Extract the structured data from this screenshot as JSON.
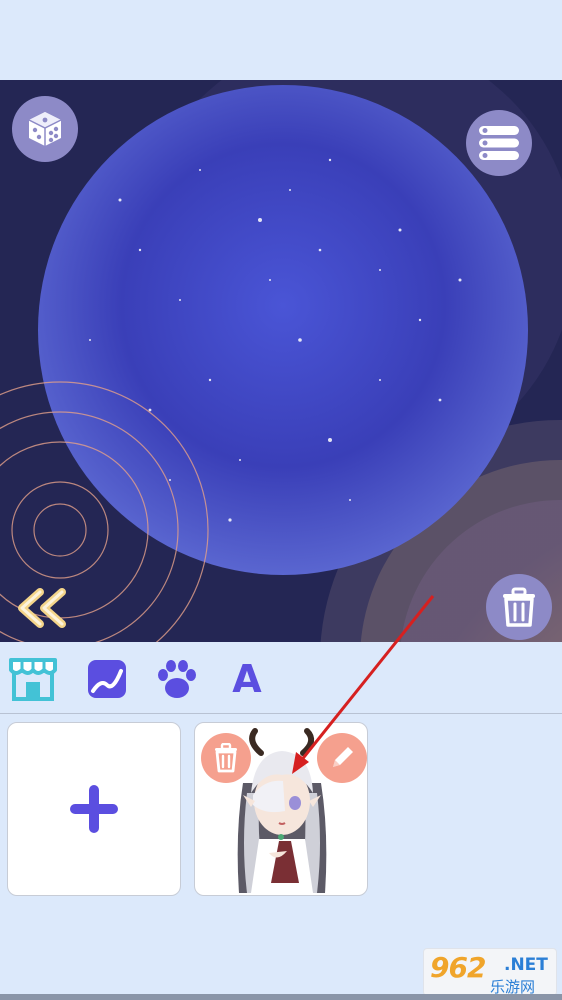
{
  "stage": {
    "background_color": "#242654",
    "planet_color": "#4048c2"
  },
  "toolbar": {
    "dice_icon": "dice-icon",
    "list_icon": "list-icon",
    "trash_icon": "trash-icon",
    "collapse_icon": "double-chevron-left-icon"
  },
  "tabs": [
    {
      "name": "shop",
      "icon": "shop-icon"
    },
    {
      "name": "background",
      "icon": "image-icon"
    },
    {
      "name": "pet",
      "icon": "paw-icon"
    },
    {
      "name": "text",
      "icon": "text-icon",
      "label": "A"
    }
  ],
  "gallery": {
    "add_icon": "plus-icon",
    "items": [
      {
        "delete_icon": "trash-icon",
        "edit_icon": "pencil-icon",
        "thumbnail": "character-avatar"
      }
    ]
  },
  "watermark": {
    "number": "962",
    "net": ".NET",
    "cn": "乐游网"
  },
  "colors": {
    "accent": "#5b4ee0",
    "button_bg": "#8d8ac7",
    "mini_button": "#f5a08e",
    "arrow": "#d62020"
  }
}
